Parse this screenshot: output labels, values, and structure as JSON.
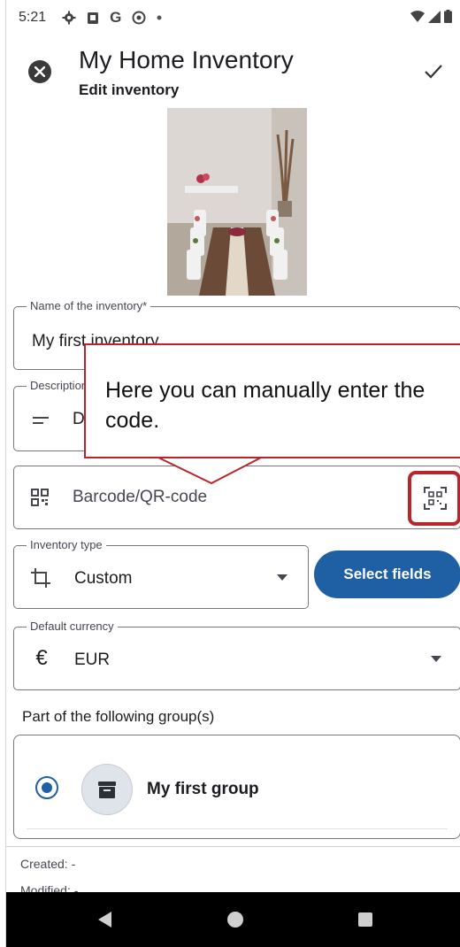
{
  "status_bar": {
    "time": "5:21",
    "icons": [
      "gear-icon",
      "clipboard-icon",
      "google-icon",
      "at-icon",
      "dot-icon"
    ],
    "right_icons": [
      "wifi-icon",
      "signal-icon",
      "battery-icon"
    ]
  },
  "header": {
    "title": "My Home Inventory",
    "subtitle": "Edit inventory"
  },
  "fields": {
    "name": {
      "label": "Name of the inventory*",
      "value": "My first inventory"
    },
    "description": {
      "label": "Description",
      "value": "D"
    },
    "barcode": {
      "placeholder": "Barcode/QR-code"
    },
    "inventory_type": {
      "label": "Inventory type",
      "value": "Custom"
    },
    "currency": {
      "label": "Default currency",
      "value": "EUR"
    }
  },
  "select_fields_label": "Select fields",
  "groups": {
    "label": "Part of the following group(s)",
    "items": [
      {
        "name": "My first group",
        "selected": true
      }
    ]
  },
  "meta": {
    "created": "Created: -",
    "modified": "Modified: -"
  },
  "tooltip": {
    "text": "Here you can manually enter the code."
  },
  "colors": {
    "accent": "#1f5fa3",
    "tooltip_border": "#b8262c",
    "outline": "#79747e"
  }
}
